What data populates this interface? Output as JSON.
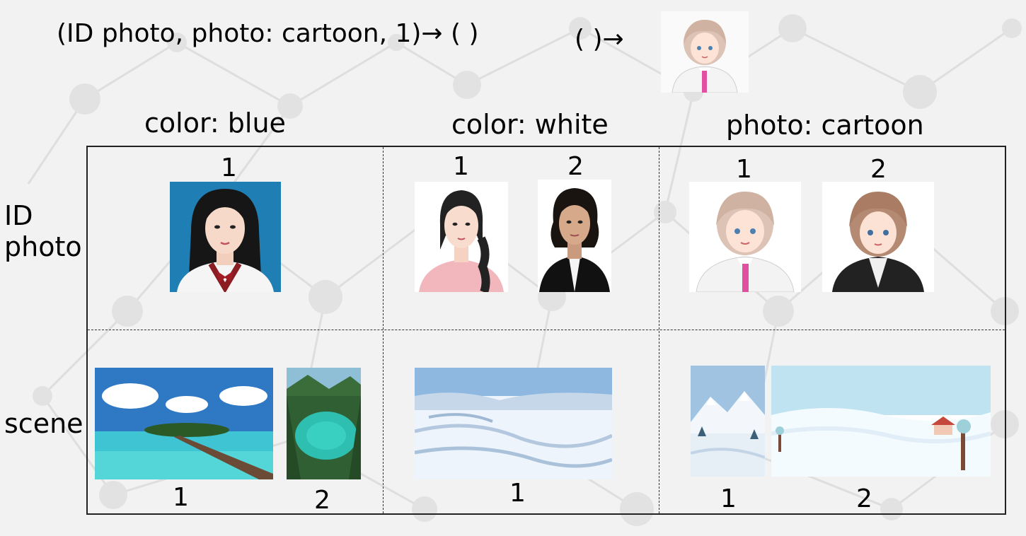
{
  "query": {
    "text": "(ID photo, photo: cartoon, 1)→  (   )",
    "answer_prefix": "(     )→",
    "answer_image": "cartoon-id-portrait-white-suit-pink-tie"
  },
  "columns": [
    {
      "label": "color: blue"
    },
    {
      "label": "color: white"
    },
    {
      "label": "photo: cartoon"
    }
  ],
  "rows": [
    {
      "label_line1": "ID",
      "label_line2": "photo"
    },
    {
      "label": "scene"
    }
  ],
  "cells": {
    "id_blue": [
      {
        "num": "1",
        "image": "id-photo-woman-blue-background-school-uniform"
      }
    ],
    "id_white": [
      {
        "num": "1",
        "image": "id-photo-woman-white-background-pink-sweater-braid"
      },
      {
        "num": "2",
        "image": "id-photo-woman-white-background-black-suit"
      }
    ],
    "id_cartoon": [
      {
        "num": "1",
        "image": "cartoon-portrait-white-suit-pink-tie"
      },
      {
        "num": "2",
        "image": "cartoon-portrait-black-suit"
      }
    ],
    "scene_blue": [
      {
        "num": "1",
        "image": "tropical-island-pier-blue-sky"
      },
      {
        "num": "2",
        "image": "turquoise-mountain-lake"
      }
    ],
    "scene_white": [
      {
        "num": "1",
        "image": "snowy-landscape-photo"
      }
    ],
    "scene_cartoon": [
      {
        "num": "1",
        "image": "cartoon-snowy-mountains"
      },
      {
        "num": "2",
        "image": "cartoon-snowy-field-house"
      }
    ]
  },
  "colors": {
    "background": "#f2f2f2",
    "network_pattern": "#dcdcdc",
    "grid_border": "#222222",
    "blue_backdrop": "#1f7fb5"
  }
}
